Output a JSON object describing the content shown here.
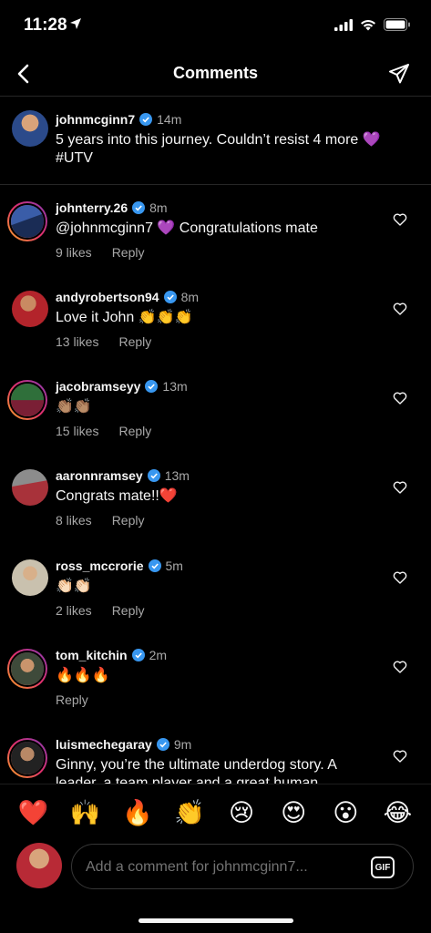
{
  "status_bar": {
    "time": "11:28"
  },
  "header": {
    "title": "Comments"
  },
  "caption": {
    "username": "johnmcginn7",
    "time": "14m",
    "text_line1": "5 years into this journey. Couldn’t resist 4 more 💜",
    "text_line2": "#UTV"
  },
  "comments": [
    {
      "username": "johnterry.26",
      "time": "8m",
      "text": "@johnmcginn7 💜 Congratulations mate",
      "likes": "9 likes",
      "reply": "Reply"
    },
    {
      "username": "andyrobertson94",
      "time": "8m",
      "text": "Love it John 👏👏👏",
      "likes": "13 likes",
      "reply": "Reply"
    },
    {
      "username": "jacobramseyy",
      "time": "13m",
      "text": "👏🏽👏🏽",
      "likes": "15 likes",
      "reply": "Reply"
    },
    {
      "username": "aaronnramsey",
      "time": "13m",
      "text": "Congrats mate!!❤️",
      "likes": "8 likes",
      "reply": "Reply"
    },
    {
      "username": "ross_mccrorie",
      "time": "5m",
      "text": "👏🏻👏🏻",
      "likes": "2 likes",
      "reply": "Reply"
    },
    {
      "username": "tom_kitchin",
      "time": "2m",
      "text": "🔥🔥🔥",
      "likes": "",
      "reply": "Reply"
    },
    {
      "username": "luismechegaray",
      "time": "9m",
      "text": "Ginny, you’re the ultimate underdog story. A leader, a team player and a great human",
      "likes": "",
      "reply": ""
    }
  ],
  "reactions": [
    "❤️",
    "🙌",
    "🔥",
    "👏",
    "😢",
    "😍",
    "😮",
    "😂"
  ],
  "composer": {
    "placeholder": "Add a comment for johnmcginn7...",
    "gif_label": "GIF"
  },
  "colors": {
    "verified": "#3897f0",
    "accent_ring": "#e1306c",
    "muted": "#a8a8a8"
  },
  "icons": [
    "back-arrow-icon",
    "send-icon",
    "heart-icon",
    "verified-badge-icon",
    "location-arrow-icon",
    "signal-icon",
    "wifi-icon",
    "battery-icon"
  ]
}
